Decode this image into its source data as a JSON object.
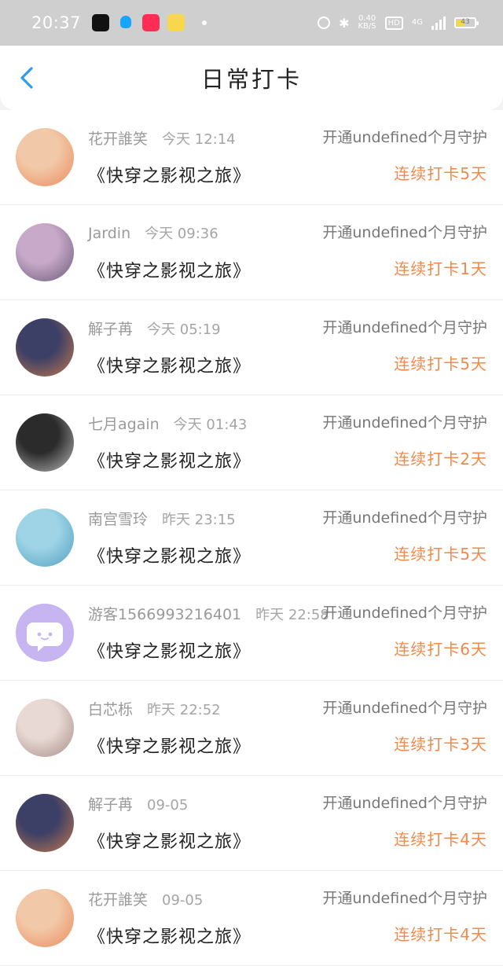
{
  "status_bar": {
    "time": "20:37",
    "net_speed_value": "0.40",
    "net_speed_unit": "KB/S",
    "hd": "HD",
    "signal": "4G",
    "battery": "43"
  },
  "header": {
    "title": "日常打卡"
  },
  "entries": [
    {
      "username": "花开誰笑",
      "time": "今天 12:14",
      "book": "《快穿之影视之旅》",
      "guard": "开通undefined个月守护",
      "streak": "连续打卡5天",
      "avatar_color": "#f2c9a8",
      "avatar_color2": "#e98a5c"
    },
    {
      "username": "Jardin",
      "time": "今天 09:36",
      "book": "《快穿之影视之旅》",
      "guard": "开通undefined个月守护",
      "streak": "连续打卡1天",
      "avatar_color": "#c8a9c9",
      "avatar_color2": "#6a5a77"
    },
    {
      "username": "解子苒",
      "time": "今天 05:19",
      "book": "《快穿之影视之旅》",
      "guard": "开通undefined个月守护",
      "streak": "连续打卡5天",
      "avatar_color": "#3c3f66",
      "avatar_color2": "#c47a4e"
    },
    {
      "username": "七月again",
      "time": "今天 01:43",
      "book": "《快穿之影视之旅》",
      "guard": "开通undefined个月守护",
      "streak": "连续打卡2天",
      "avatar_color": "#2b2b2b",
      "avatar_color2": "#bbbbbb"
    },
    {
      "username": "南宫雪玲",
      "time": "昨天 23:15",
      "book": "《快穿之影视之旅》",
      "guard": "开通undefined个月守护",
      "streak": "连续打卡5天",
      "avatar_color": "#9fd4e6",
      "avatar_color2": "#4f9fbf"
    },
    {
      "username": "游客1566993216401",
      "time": "昨天 22:58",
      "book": "《快穿之影视之旅》",
      "guard": "开通undefined个月守护",
      "streak": "连续打卡6天",
      "avatar_color": "#c7b5f1",
      "avatar_color2": "#c7b5f1",
      "avatar_icon": "chat-bubble-icon"
    },
    {
      "username": "白芯栎",
      "time": "昨天 22:52",
      "book": "《快穿之影视之旅》",
      "guard": "开通undefined个月守护",
      "streak": "连续打卡3天",
      "avatar_color": "#e9d9d4",
      "avatar_color2": "#a58c86"
    },
    {
      "username": "解子苒",
      "time": "09-05",
      "book": "《快穿之影视之旅》",
      "guard": "开通undefined个月守护",
      "streak": "连续打卡4天",
      "avatar_color": "#3c3f66",
      "avatar_color2": "#c47a4e"
    },
    {
      "username": "花开誰笑",
      "time": "09-05",
      "book": "《快穿之影视之旅》",
      "guard": "开通undefined个月守护",
      "streak": "连续打卡4天",
      "avatar_color": "#f2c9a8",
      "avatar_color2": "#e98a5c"
    }
  ],
  "colors": {
    "accent": "#f08a4b",
    "back_arrow": "#2e9ee8"
  }
}
